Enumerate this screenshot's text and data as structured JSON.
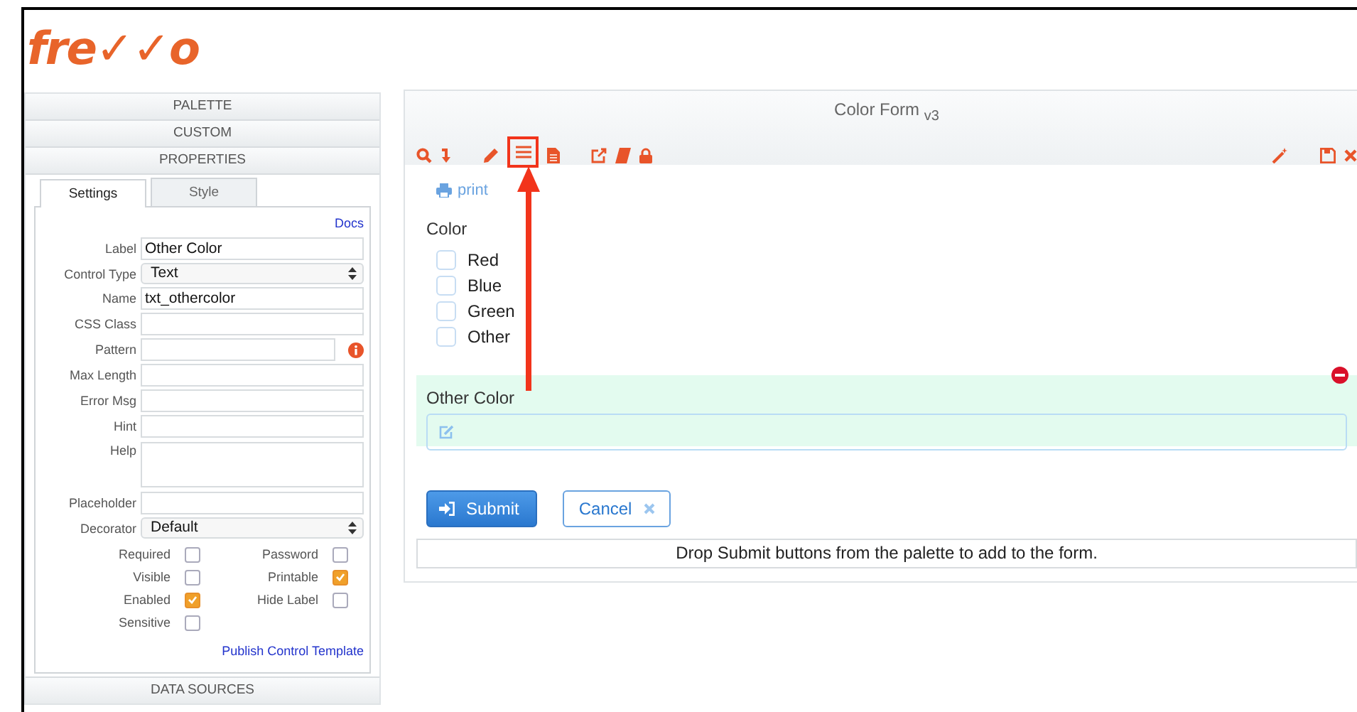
{
  "logo": "fre✓✓o",
  "left_panel": {
    "sections": [
      "PALETTE",
      "CUSTOM",
      "PROPERTIES"
    ],
    "tabs": [
      {
        "label": "Settings",
        "selected": true
      },
      {
        "label": "Style",
        "selected": false
      }
    ],
    "docs_link": "Docs",
    "fields": [
      {
        "label": "Label",
        "kind": "text",
        "value": "Other Color"
      },
      {
        "label": "Control Type",
        "kind": "select",
        "value": "Text"
      },
      {
        "label": "Name",
        "kind": "text",
        "value": "txt_othercolor"
      },
      {
        "label": "CSS Class",
        "kind": "text"
      },
      {
        "label": "Pattern",
        "kind": "info"
      },
      {
        "label": "Max Length",
        "kind": "text"
      },
      {
        "label": "Error Msg",
        "kind": "text"
      },
      {
        "label": "Hint",
        "kind": "text"
      },
      {
        "label": "Help",
        "kind": "textarea"
      },
      {
        "label": "Placeholder",
        "kind": "text"
      },
      {
        "label": "Decorator",
        "kind": "select",
        "value": "Default"
      }
    ],
    "options": [
      {
        "label": "Required",
        "checked": false
      },
      {
        "label": "Password",
        "checked": false
      },
      {
        "label": "Visible",
        "checked": false
      },
      {
        "label": "Printable",
        "checked": true
      },
      {
        "label": "Enabled",
        "checked": true
      },
      {
        "label": "Hide Label",
        "checked": false
      },
      {
        "label": "Sensitive",
        "checked": false
      }
    ],
    "publish_link": "Publish Control Template",
    "footer_section": "DATA SOURCES"
  },
  "form": {
    "title": "Color Form $_{v3}$",
    "print_link": "print",
    "checkbox_group": {
      "label": "Color",
      "items": [
        {
          "label": "Red",
          "checked": false
        },
        {
          "label": "Blue",
          "checked": false
        },
        {
          "label": "Green",
          "checked": false
        },
        {
          "label": "Other",
          "checked": false
        }
      ]
    },
    "selected_control": {
      "label": "Other Color"
    },
    "buttons": [
      {
        "label": "Submit",
        "kind": "primary"
      },
      {
        "label": "Cancel",
        "kind": "secondary"
      }
    ],
    "drop_message": "Drop Submit buttons from the palette to add to the form."
  }
}
